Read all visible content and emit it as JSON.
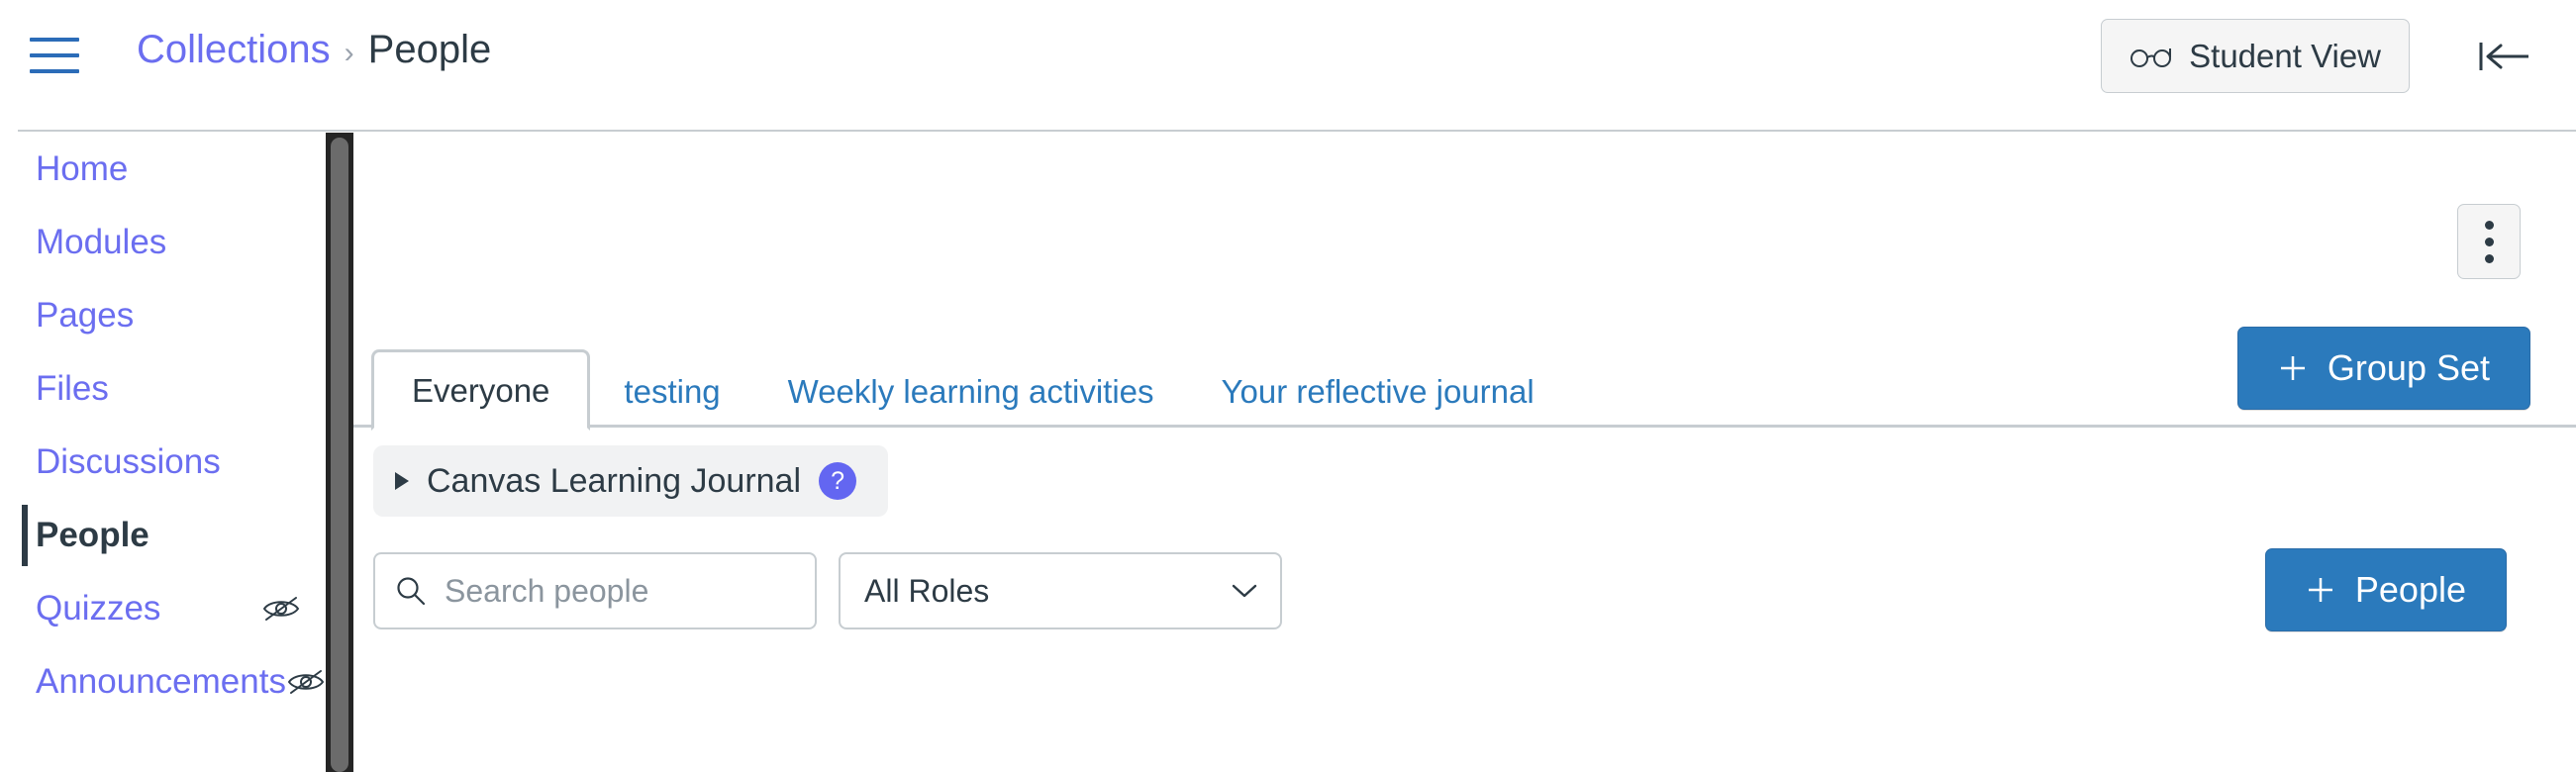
{
  "header": {
    "menu_icon": "hamburger-icon",
    "breadcrumb": {
      "parent": "Collections",
      "separator": "›",
      "current": "People"
    },
    "student_view_label": "Student View",
    "student_view_icon": "glasses-icon",
    "collapse_icon": "collapse-panel-icon"
  },
  "sidebar": {
    "items": [
      {
        "label": "Home",
        "active": false,
        "hidden_from_students": false
      },
      {
        "label": "Modules",
        "active": false,
        "hidden_from_students": false
      },
      {
        "label": "Pages",
        "active": false,
        "hidden_from_students": false
      },
      {
        "label": "Files",
        "active": false,
        "hidden_from_students": false
      },
      {
        "label": "Discussions",
        "active": false,
        "hidden_from_students": false
      },
      {
        "label": "People",
        "active": true,
        "hidden_from_students": false
      },
      {
        "label": "Quizzes",
        "active": false,
        "hidden_from_students": true
      },
      {
        "label": "Announcements",
        "active": false,
        "hidden_from_students": true
      }
    ]
  },
  "main": {
    "kebab_icon": "more-options-icon",
    "tabs": [
      {
        "label": "Everyone",
        "active": true
      },
      {
        "label": "testing",
        "active": false
      },
      {
        "label": "Weekly learning activities",
        "active": false
      },
      {
        "label": "Your reflective journal",
        "active": false
      }
    ],
    "group_set_button": {
      "label": "Group Set",
      "icon": "plus-icon"
    },
    "journal_row": {
      "label": "Canvas Learning Journal",
      "caret_icon": "caret-right-icon",
      "help_badge": "?"
    },
    "search": {
      "placeholder": "Search people",
      "value": "",
      "icon": "search-icon"
    },
    "roles_filter": {
      "selected": "All Roles",
      "chevron_icon": "chevron-down-icon"
    },
    "people_button": {
      "label": "People",
      "icon": "plus-icon"
    }
  },
  "colors": {
    "link_blue": "#2b7abc",
    "nav_periwinkle": "#6b6ef0",
    "primary_button": "#2b7abc",
    "text_dark": "#2d3b45",
    "border_gray": "#c7cdd1",
    "help_badge": "#6366f1",
    "scrollbar_track": "#252525",
    "scrollbar_thumb": "#6b6b6b"
  }
}
